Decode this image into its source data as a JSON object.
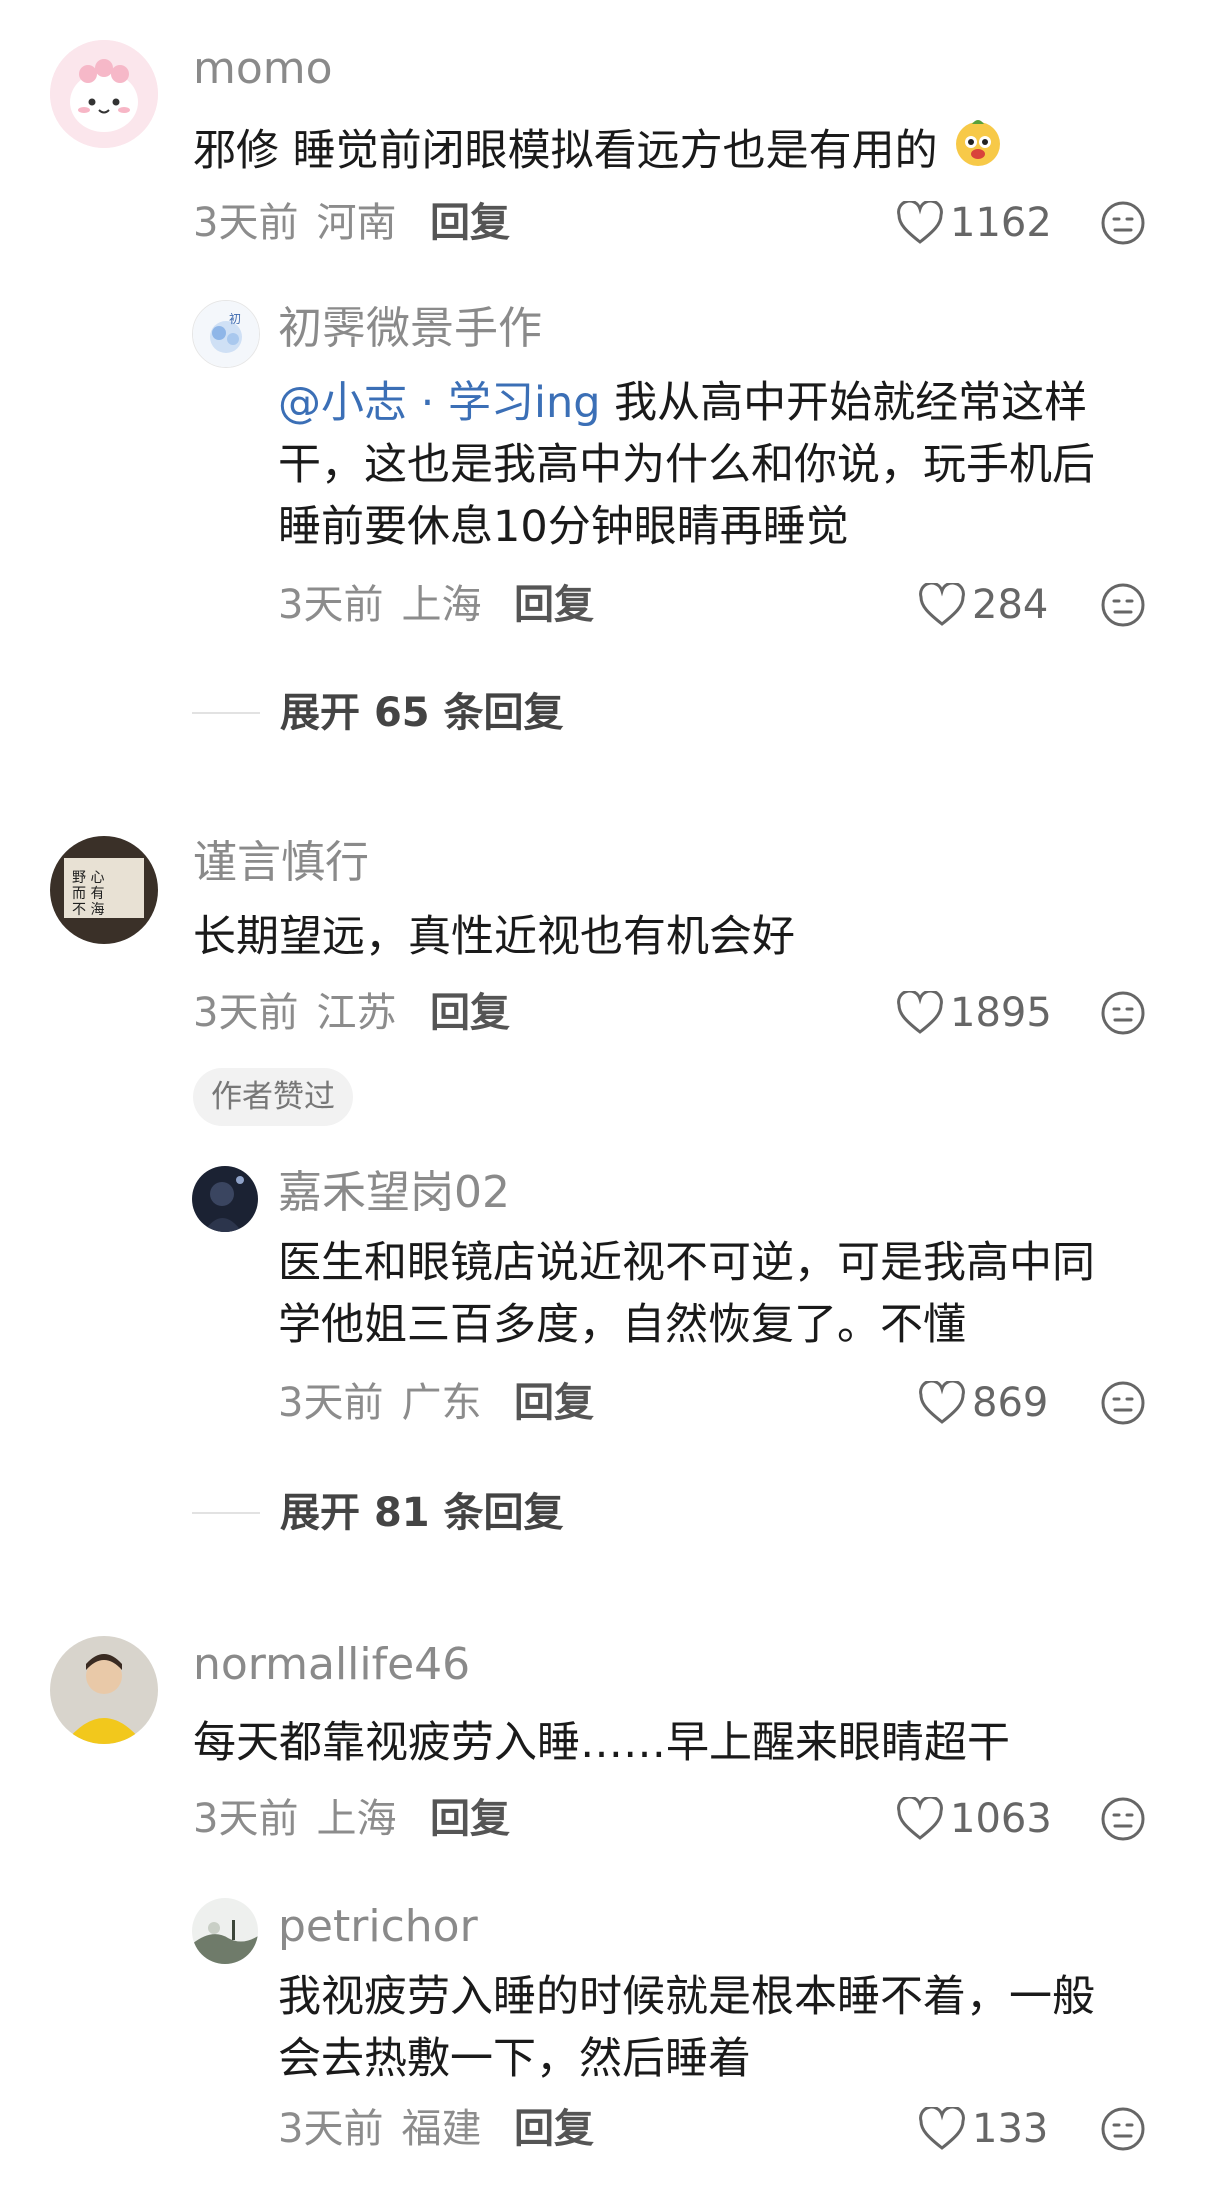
{
  "colors": {
    "username": "#8a8a8a",
    "mention": "#3b6fb6",
    "meta": "#8c8c8c"
  },
  "comments": [
    {
      "user": "momo",
      "avatar_icon": "pink-cartoon-avatar",
      "text": "邪修 睡觉前闭眼模拟看远方也是有用的",
      "emoji_icon": "cartoon-emoji",
      "time": "3天前",
      "region": "河南",
      "reply_label": "回复",
      "likes": "1162",
      "reply": {
        "user": "初霁微景手作",
        "mention": "@小志 · 学习ing",
        "text_line1": " 我从高中开始就经常这样",
        "text_line2": "干，这也是我高中为什么和你说，玩手机后",
        "text_line3": "睡前要休息10分钟眼睛再睡觉",
        "time": "3天前",
        "region": "上海",
        "reply_label": "回复",
        "likes": "284"
      },
      "expand": {
        "prefix": "展开",
        "count": "65",
        "suffix": "条回复"
      }
    },
    {
      "user": "谨言慎行",
      "avatar_icon": "calligraphy-avatar",
      "text": "长期望远，真性近视也有机会好",
      "time": "3天前",
      "region": "江苏",
      "reply_label": "回复",
      "likes": "1895",
      "badge": "作者赞过",
      "reply": {
        "user": "嘉禾望岗02",
        "text_line1": "医生和眼镜店说近视不可逆，可是我高中同",
        "text_line2": "学他姐三百多度，自然恢复了。不懂",
        "time": "3天前",
        "region": "广东",
        "reply_label": "回复",
        "likes": "869"
      },
      "expand": {
        "prefix": "展开",
        "count": "81",
        "suffix": "条回复"
      }
    },
    {
      "user": "normallife46",
      "avatar_icon": "person-photo-avatar",
      "text": "每天都靠视疲劳入睡……早上醒来眼睛超干",
      "time": "3天前",
      "region": "上海",
      "reply_label": "回复",
      "likes": "1063",
      "reply": {
        "user": "petrichor",
        "text_line1": "我视疲劳入睡的时候就是根本睡不着，一般",
        "text_line2": "会去热敷一下，然后睡着",
        "time": "3天前",
        "region": "福建",
        "reply_label": "回复",
        "likes": "133"
      }
    }
  ]
}
